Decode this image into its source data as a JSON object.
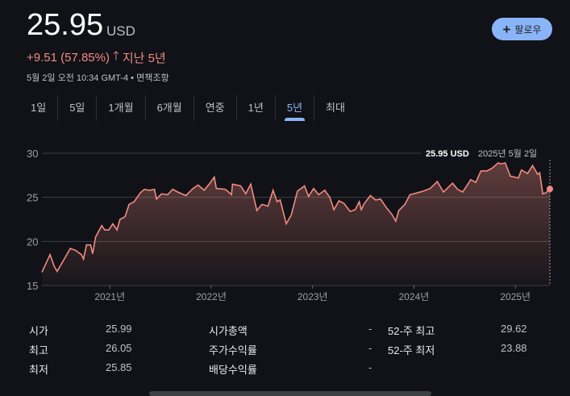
{
  "header": {
    "price": "25.95",
    "currency": "USD",
    "change": "+9.51 (57.85%)",
    "change_arrow_icon": "arrow-up-icon",
    "period": "지난 5년",
    "timestamp": "5월 2일 오전 10:34 GMT-4",
    "separator": "•",
    "disclaimer": "면책조항",
    "follow_label": "팔로우",
    "colors": {
      "negative_positive": "#f28b82",
      "accent": "#8ab4f8"
    }
  },
  "tabs": [
    {
      "label": "1일"
    },
    {
      "label": "5일"
    },
    {
      "label": "1개월"
    },
    {
      "label": "6개월"
    },
    {
      "label": "연중"
    },
    {
      "label": "1년"
    },
    {
      "label": "5년",
      "active": true
    },
    {
      "label": "최대"
    }
  ],
  "tooltip": {
    "price": "25.95 USD",
    "date": "2025년 5월 2일"
  },
  "chart_data": {
    "type": "area",
    "title": "",
    "xlabel": "",
    "ylabel": "",
    "ylim": [
      15,
      30
    ],
    "xlim": [
      2020.33,
      2025.34
    ],
    "y_ticks": [
      "15",
      "20",
      "25",
      "30"
    ],
    "x_ticks": [
      {
        "value": 2021,
        "label": "2021년"
      },
      {
        "value": 2022,
        "label": "2022년"
      },
      {
        "value": 2023,
        "label": "2023년"
      },
      {
        "value": 2024,
        "label": "2024년"
      },
      {
        "value": 2025,
        "label": "2025년"
      }
    ],
    "grid": true,
    "line_color": "#f28b82",
    "series": [
      {
        "name": "price",
        "x": [
          2020.33,
          2020.41,
          2020.45,
          2020.48,
          2020.54,
          2020.61,
          2020.66,
          2020.72,
          2020.74,
          2020.77,
          2020.81,
          2020.83,
          2020.86,
          2020.92,
          2020.95,
          2020.99,
          2021.03,
          2021.07,
          2021.1,
          2021.15,
          2021.19,
          2021.24,
          2021.3,
          2021.34,
          2021.39,
          2021.44,
          2021.46,
          2021.51,
          2021.57,
          2021.62,
          2021.67,
          2021.75,
          2021.82,
          2021.87,
          2021.93,
          2021.98,
          2022.03,
          2022.05,
          2022.14,
          2022.2,
          2022.21,
          2022.29,
          2022.34,
          2022.39,
          2022.45,
          2022.5,
          2022.56,
          2022.61,
          2022.65,
          2022.68,
          2022.74,
          2022.79,
          2022.85,
          2022.92,
          2022.96,
          2023.01,
          2023.06,
          2023.12,
          2023.17,
          2023.21,
          2023.26,
          2023.31,
          2023.37,
          2023.42,
          2023.46,
          2023.48,
          2023.51,
          2023.57,
          2023.62,
          2023.67,
          2023.73,
          2023.78,
          2023.82,
          2023.85,
          2023.91,
          2023.96,
          2024.03,
          2024.09,
          2024.16,
          2024.23,
          2024.29,
          2024.38,
          2024.43,
          2024.48,
          2024.56,
          2024.61,
          2024.66,
          2024.72,
          2024.77,
          2024.83,
          2024.86,
          2024.9,
          2024.95,
          2025.03,
          2025.06,
          2025.12,
          2025.17,
          2025.22,
          2025.24,
          2025.27,
          2025.3,
          2025.34
        ],
        "y": [
          16.5,
          18.5,
          17.2,
          16.6,
          17.8,
          19.2,
          19.0,
          18.5,
          18.0,
          19.6,
          19.6,
          18.6,
          20.5,
          21.8,
          21.3,
          21.3,
          22.0,
          21.3,
          22.5,
          22.8,
          24.2,
          24.5,
          25.5,
          25.9,
          25.8,
          25.9,
          24.8,
          25.4,
          25.3,
          25.9,
          25.6,
          25.2,
          26.0,
          26.4,
          25.8,
          26.5,
          27.3,
          26.0,
          25.9,
          25.3,
          26.5,
          26.3,
          25.4,
          26.5,
          23.5,
          24.2,
          24.0,
          25.8,
          24.5,
          24.7,
          22.0,
          23.0,
          25.7,
          26.3,
          25.1,
          26.0,
          25.3,
          25.8,
          25.0,
          23.6,
          24.6,
          24.3,
          23.4,
          23.6,
          24.5,
          23.6,
          24.3,
          25.2,
          24.7,
          24.8,
          23.8,
          23.1,
          22.3,
          23.5,
          24.2,
          25.3,
          25.5,
          25.7,
          26.0,
          26.8,
          25.6,
          26.6,
          25.9,
          25.6,
          27.0,
          26.7,
          28.0,
          28.0,
          28.3,
          28.9,
          28.8,
          28.9,
          27.4,
          27.2,
          28.1,
          27.7,
          28.6,
          27.6,
          27.8,
          25.4,
          25.5,
          25.95
        ]
      }
    ]
  },
  "stats": {
    "col1": [
      {
        "label": "시가",
        "value": "25.99"
      },
      {
        "label": "최고",
        "value": "26.05"
      },
      {
        "label": "최저",
        "value": "25.85"
      }
    ],
    "col2": [
      {
        "label": "시가총액",
        "value": "-"
      },
      {
        "label": "주가수익률",
        "value": "-"
      },
      {
        "label": "배당수익률",
        "value": "-"
      }
    ],
    "col3": [
      {
        "label": "52-주 최고",
        "value": "29.62"
      },
      {
        "label": "52-주 최저",
        "value": "23.88"
      }
    ]
  }
}
